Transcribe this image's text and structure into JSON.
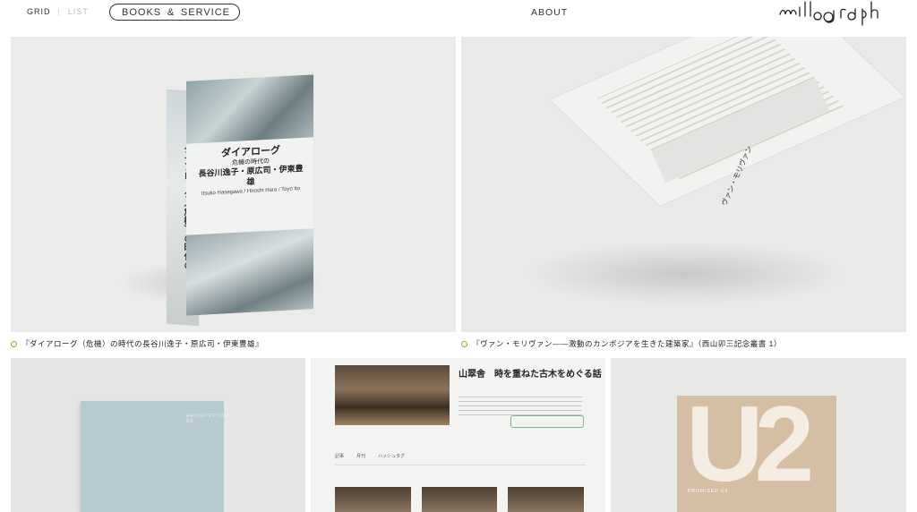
{
  "header": {
    "view_grid": "GRID",
    "view_list": "LIST",
    "nav_books": "BOOKS",
    "nav_amp": "&",
    "nav_service": "SERVICE",
    "nav_about": "ABOUT",
    "logo_text": "millegraph"
  },
  "items": [
    {
      "caption": "『ダイアローグ（危機）の時代の長谷川逸子・原広司・伊東豊雄』",
      "cover_title": "ダイアローグ",
      "cover_subtitle": "危機の時代の",
      "cover_names": "長谷川逸子・原広司・伊東豊雄",
      "cover_romaji": "Itsuko Hasegawa / Hiroshi Hara / Toyo Ito",
      "spine_text": "ダイアローグ〈危機〉の時代の"
    },
    {
      "caption": "『ヴァン・モリヴァン——激動のカンボジアを生きた建築家』（西山卯三記念叢書 1）",
      "spine_text": "ヴァン・モリヴァン"
    },
    {
      "cover_text": "ARCHITECTURE OF"
    },
    {
      "article_title": "山翠舎　時を重ねた古木をめぐる話",
      "tab_1": "記事",
      "tab_2": "月刊",
      "tab_3": "ハッシュタグ"
    },
    {
      "cover_mark": "U2",
      "cover_label": "PROMISED U2"
    }
  ],
  "colors": {
    "caption_dot": "#9aa32c",
    "card_bg": "#ebebea",
    "accent_green": "#7bb59a"
  }
}
